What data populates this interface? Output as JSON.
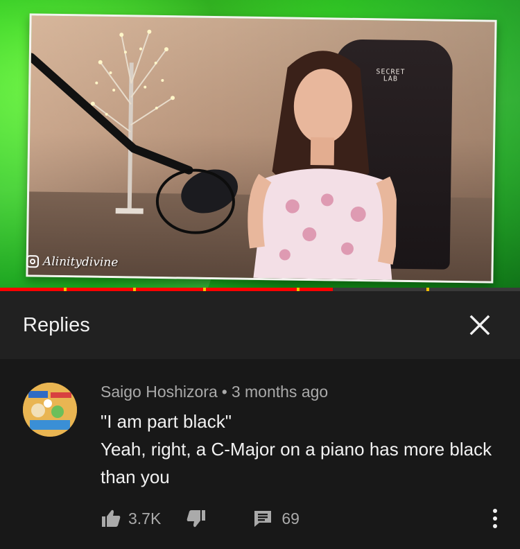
{
  "video": {
    "watermark_handle": "Alinitydivine",
    "chair_brand_line1": "SECRET",
    "chair_brand_line2": "LAB",
    "progress_fraction": 0.64
  },
  "replies_panel": {
    "title": "Replies"
  },
  "comment": {
    "author": "Saigo Hoshizora",
    "separator": "•",
    "time": "3 months ago",
    "line1": "\"I am part black\"",
    "line2": "Yeah, right, a C-Major on a piano has more black than you",
    "like_count": "3.7K",
    "reply_count": "69"
  },
  "icons": {
    "close": "close-icon",
    "like": "thumbs-up-icon",
    "dislike": "thumbs-down-icon",
    "reply": "reply-comment-icon",
    "more": "more-vertical-icon",
    "watermark": "instagram-icon"
  },
  "colors": {
    "background": "#181818",
    "header_bg": "#212121",
    "progress": "#ff0000",
    "muted_text": "#aaaaaa",
    "primary_text": "#f1f1f1"
  }
}
